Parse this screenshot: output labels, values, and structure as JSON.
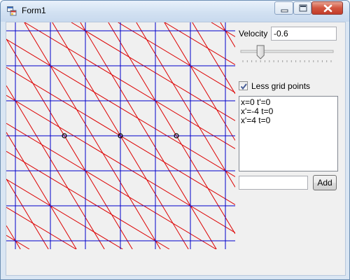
{
  "window": {
    "title": "Form1"
  },
  "controls": {
    "velocity_label": "Velocity",
    "velocity_value": "-0.6",
    "velocity_slider_fraction": 0.2,
    "less_grid_label": "Less grid points",
    "less_grid_checked": true,
    "add_label": "Add",
    "add_value": ""
  },
  "list": {
    "items": [
      "x=0 t'=0",
      "x'=-4 t=0",
      "x'=4 t=0"
    ]
  },
  "plot": {
    "grid_color": "#0000cc",
    "transformed_color": "#dd0000",
    "marker_color": "#000000",
    "velocity": -0.6
  }
}
